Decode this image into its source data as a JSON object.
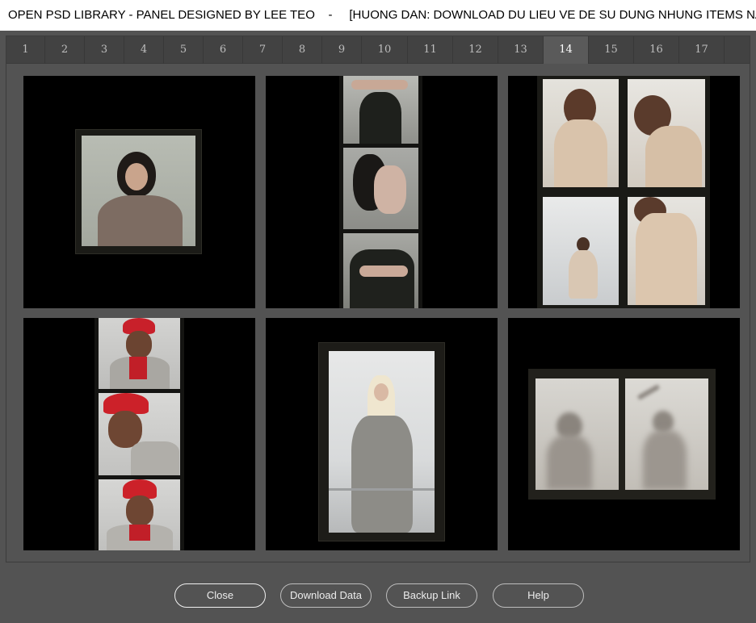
{
  "window": {
    "title": "OPEN PSD LIBRARY - PANEL DESIGNED BY LEE TEO    -     [HUONG DAN: DOWNLOAD DU LIEU VE DE SU DUNG NHUNG ITEMS NAY]"
  },
  "tabs": [
    "1",
    "2",
    "3",
    "4",
    "5",
    "6",
    "7",
    "8",
    "9",
    "10",
    "11",
    "12",
    "13",
    "14",
    "15",
    "16",
    "17"
  ],
  "active_tab": "14",
  "colors": {
    "panel": "#535353",
    "tab_bar": "#424242",
    "tab_active": "#5a5a5a",
    "thumbnail_bg": "#000000"
  },
  "buttons": {
    "close": "Close",
    "download": "Download Data",
    "backup": "Backup Link",
    "help": "Help"
  }
}
